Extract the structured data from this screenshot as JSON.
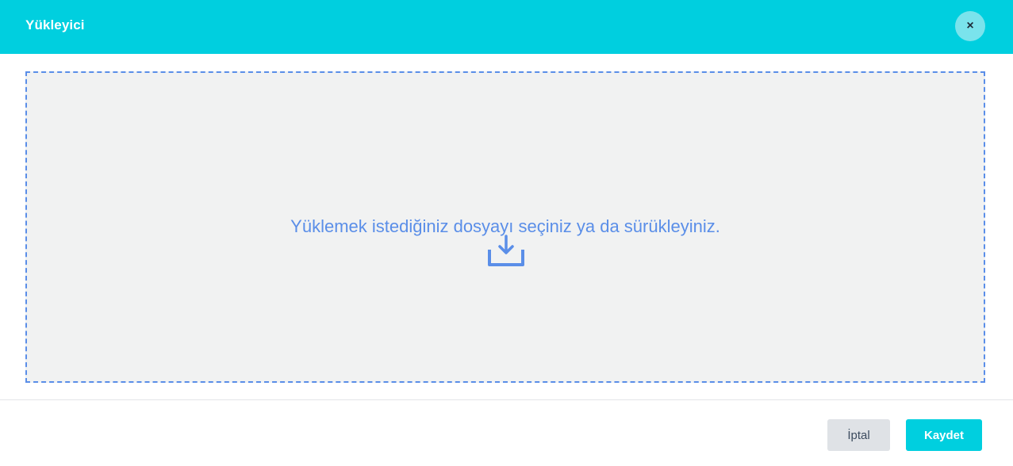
{
  "header": {
    "title": "Yükleyici",
    "close_label": "×"
  },
  "dropzone": {
    "text": "Yüklemek istediğiniz dosyayı seçiniz ya da sürükleyiniz.",
    "icon": "upload-tray-icon"
  },
  "footer": {
    "cancel_label": "İptal",
    "save_label": "Kaydet"
  },
  "colors": {
    "accent": "#00cfdf",
    "dropzone_border": "#5a8ee8",
    "dropzone_bg": "#f1f2f2",
    "cancel_bg": "#dfe2e6"
  }
}
